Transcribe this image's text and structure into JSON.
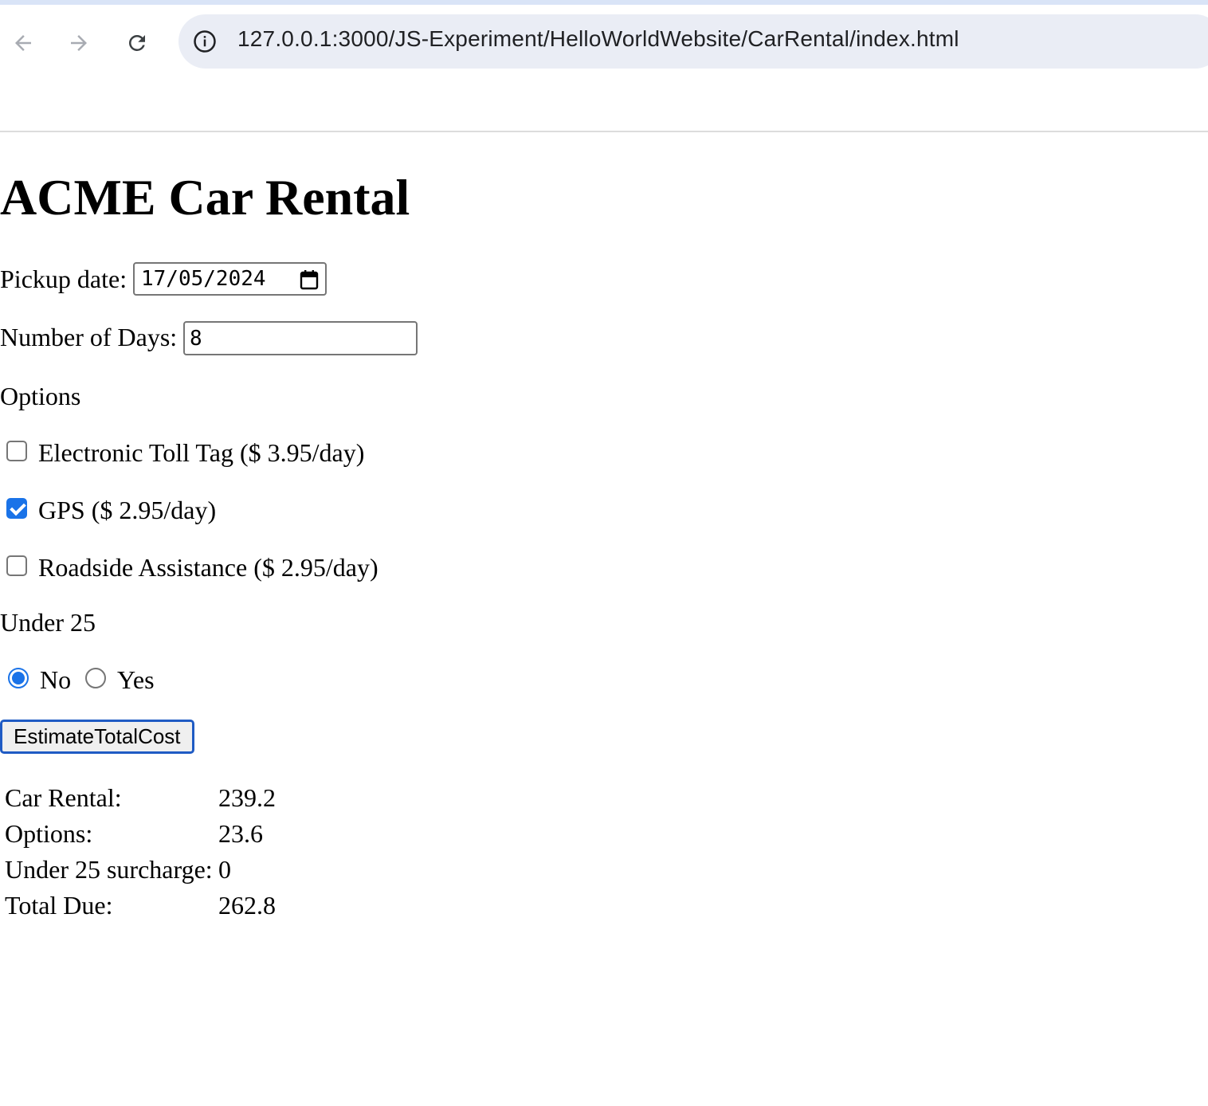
{
  "browser": {
    "url": "127.0.0.1:3000/JS-Experiment/HelloWorldWebsite/CarRental/index.html",
    "icons": [
      "back-arrow-icon",
      "forward-arrow-icon",
      "reload-icon",
      "site-info-icon"
    ]
  },
  "page": {
    "title": "ACME Car Rental",
    "pickup_label": "Pickup date:",
    "pickup_value": "17/05/2024",
    "days_label": "Number of Days:",
    "days_value": "8",
    "options_heading": "Options",
    "options": [
      {
        "label": "Electronic Toll Tag ($ 3.95/day)",
        "checked": false
      },
      {
        "label": "GPS ($ 2.95/day)",
        "checked": true
      },
      {
        "label": "Roadside Assistance ($ 2.95/day)",
        "checked": false
      }
    ],
    "under25_heading": "Under 25",
    "under25_options": [
      {
        "label": "No",
        "selected": true
      },
      {
        "label": "Yes",
        "selected": false
      }
    ],
    "estimate_button": "EstimateTotalCost",
    "results": [
      {
        "label": "Car Rental:",
        "value": "239.2"
      },
      {
        "label": "Options:",
        "value": "23.6"
      },
      {
        "label": "Under 25 surcharge:",
        "value": "0"
      },
      {
        "label": "Total Due:",
        "value": "262.8"
      }
    ]
  },
  "colors": {
    "accent": "#1a73e8",
    "button_border": "#1f5bc4",
    "address_bar_bg": "#eaedf5"
  }
}
